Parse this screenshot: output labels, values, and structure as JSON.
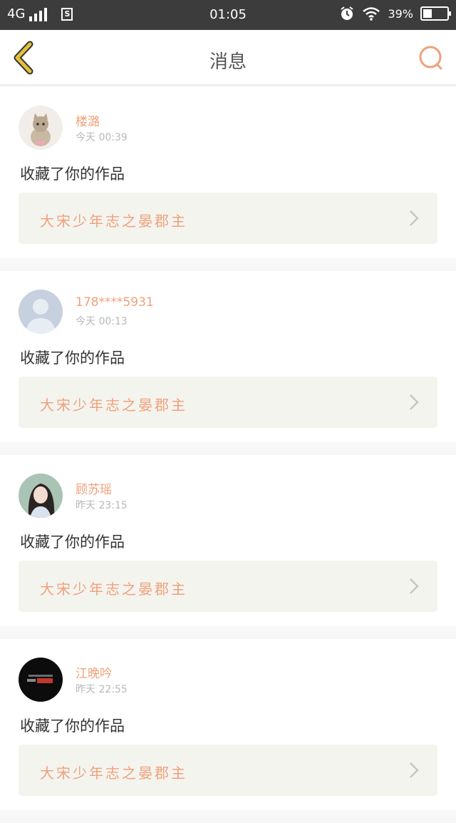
{
  "status_bar": {
    "network": "4G",
    "time": "01:05",
    "battery_percent": "39%",
    "battery_level": 0.39
  },
  "header": {
    "title": "消息"
  },
  "messages": [
    {
      "username": "楼潞",
      "time": "今天 00:39",
      "action": "收藏了你的作品",
      "work_title": "大宋少年志之晏郡主",
      "avatar": "kitten-avatar"
    },
    {
      "username": "178****5931",
      "time": "今天 00:13",
      "action": "收藏了你的作品",
      "work_title": "大宋少年志之晏郡主",
      "avatar": "default-user-avatar"
    },
    {
      "username": "顾苏瑶",
      "time": "昨天 23:15",
      "action": "收藏了你的作品",
      "work_title": "大宋少年志之晏郡主",
      "avatar": "girl-photo-avatar"
    },
    {
      "username": "江晚吟",
      "time": "昨天 22:55",
      "action": "收藏了你的作品",
      "work_title": "大宋少年志之晏郡主",
      "avatar": "black-logo-avatar"
    }
  ],
  "colors": {
    "accent": "#f0a07a",
    "back_icon": "#e2c03a",
    "work_box_bg": "#f4f4ef"
  }
}
